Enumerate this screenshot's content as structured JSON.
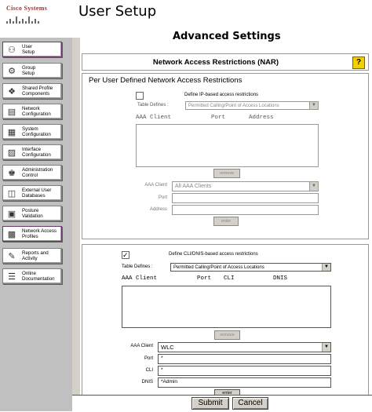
{
  "logo": {
    "text": "Cisco Systems"
  },
  "header": {
    "title": "User Setup"
  },
  "sidebar": {
    "items": [
      {
        "label": "User\nSetup",
        "icon": "user-icon"
      },
      {
        "label": "Group\nSetup",
        "icon": "group-icon"
      },
      {
        "label": "Shared Profile\nComponents",
        "icon": "shared-profile-icon"
      },
      {
        "label": "Network\nConfiguration",
        "icon": "network-icon"
      },
      {
        "label": "System\nConfiguration",
        "icon": "system-icon"
      },
      {
        "label": "Interface\nConfiguration",
        "icon": "interface-icon"
      },
      {
        "label": "Administration\nControl",
        "icon": "admin-icon"
      },
      {
        "label": "External User\nDatabases",
        "icon": "database-icon"
      },
      {
        "label": "Posture\nValidation",
        "icon": "posture-icon"
      },
      {
        "label": "Network Access\nProfiles",
        "icon": "network-access-icon"
      },
      {
        "label": "Reports and\nActivity",
        "icon": "reports-icon"
      },
      {
        "label": "Online\nDocumentation",
        "icon": "documentation-icon"
      }
    ]
  },
  "main": {
    "title": "Advanced Settings",
    "nar_title": "Network Access Restrictions (NAR)",
    "help": "?",
    "section1": {
      "heading": "Per User Defined Network Access Restrictions",
      "checkbox_label": "Define IP-based access restrictions",
      "table_defines_label": "Table Defines :",
      "table_defines_value": "Permitted Calling/Point of Access Locations",
      "columns": [
        "AAA Client",
        "Port",
        "Address"
      ],
      "remove_label": "remove",
      "aaa_client_label": "AAA Client",
      "aaa_client_value": "All AAA Clients",
      "port_label": "Port",
      "address_label": "Address",
      "enter_label": "enter"
    },
    "section2": {
      "checkbox_label": "Define CLI/DNIS-based access restrictions",
      "checkbox_mark": "✓",
      "table_defines_label": "Table Defines :",
      "table_defines_value": "Permitted Calling/Point of Access Locations",
      "columns": [
        "AAA Client",
        "Port",
        "CLI",
        "DNIS"
      ],
      "remove_label": "remove",
      "aaa_client_label": "AAA Client",
      "aaa_client_value": "WLC",
      "port_label": "Port",
      "port_value": "*",
      "cli_label": "CLI",
      "cli_value": "*",
      "dnis_label": "DNIS",
      "dnis_value": "*Admin",
      "enter_label": "enter"
    }
  },
  "footer": {
    "submit_label": "Submit",
    "cancel_label": "Cancel"
  }
}
